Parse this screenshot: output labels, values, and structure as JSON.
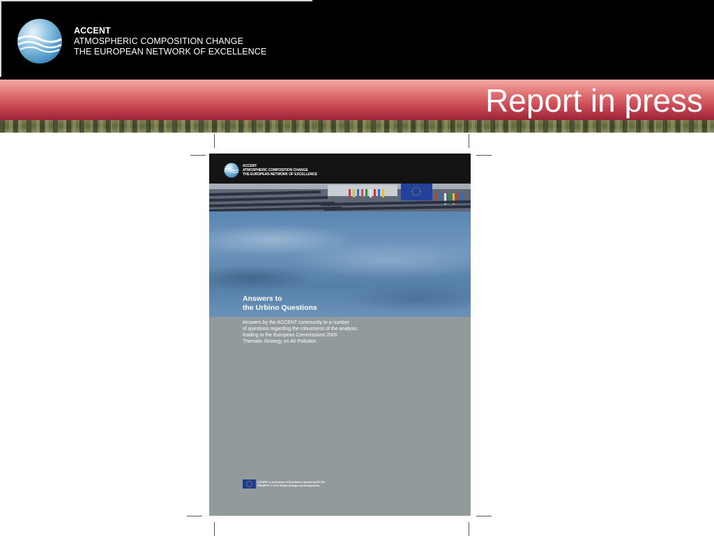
{
  "header": {
    "org_lines": [
      "ACCENT",
      "ATMOSPHERIC COMPOSITION CHANGE",
      "THE EUROPEAN NETWORK OF EXCELLENCE"
    ]
  },
  "banner": {
    "title": "Report in press"
  },
  "cover": {
    "org_lines": [
      "ACCENT",
      "ATMOSPHERIC COMPOSITION CHANGE",
      "THE EUROPEAN NETWORK OF EXCELLENCE"
    ],
    "title_lines": [
      "Answers to",
      "the Urbino Questions"
    ],
    "description_lines": [
      "Answers by the ACCENT community to a number",
      "of questions regarding the robustness of the analysis",
      "leading to the European Commissions 2005",
      "Thematic Strategy on Air Pollution."
    ],
    "footer_lines": [
      "ACCENT is a Network of Excellence funded by EC 6th",
      "PRIORITY 1.1.6.3 Global Change and Ecosystems"
    ]
  },
  "colors": {
    "header_bg": "#000000",
    "banner_accent": "#c94a55",
    "cover_gray": "#939a9c",
    "sky_blue": "#5a86b2"
  },
  "icons": {
    "logo": "globe-waves-icon",
    "eu": "eu-flag-icon"
  }
}
